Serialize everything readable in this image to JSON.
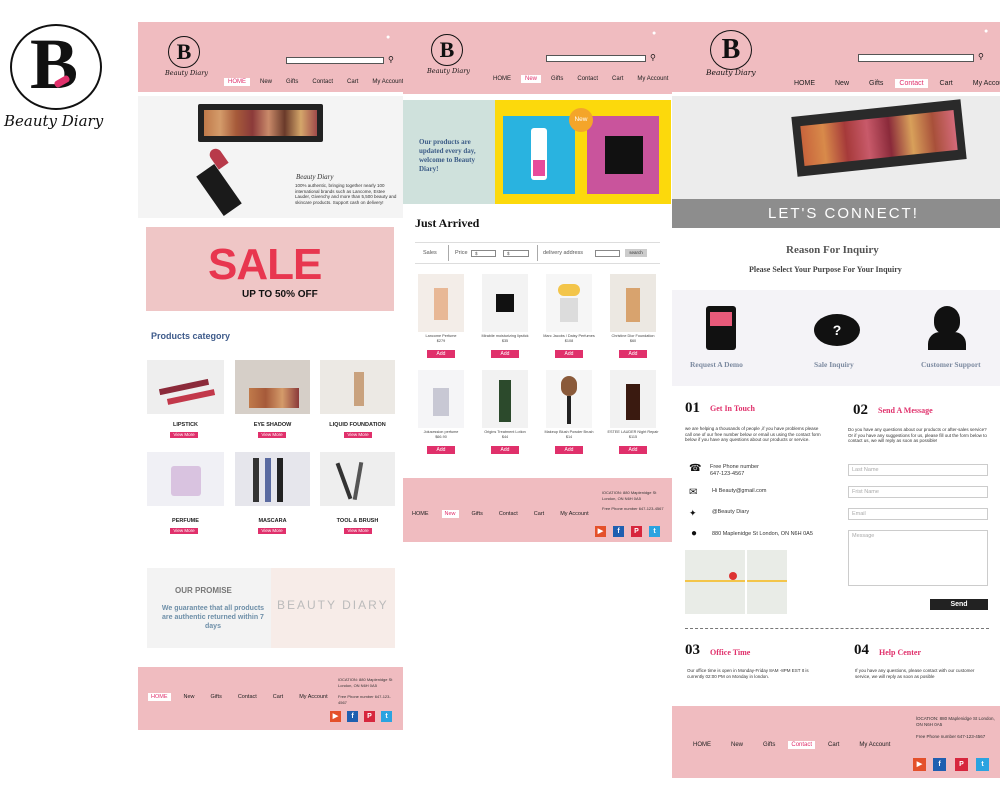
{
  "brand": {
    "initial": "B",
    "script": "Beauty Diary"
  },
  "nav": [
    "HOME",
    "New",
    "Gifts",
    "Contact",
    "Cart",
    "My Account"
  ],
  "home": {
    "hero_brand": "Beauty Diary",
    "hero_text": "100% authentic, bringing together nearly 100 international brands such as Lancome, Estee Lauder, Givenchy and more than 5,500 beauty and skincare products. Support cash on delivery!",
    "sale_title": "SALE",
    "sale_sub": "UP TO 50% OFF",
    "category_title": "Products category",
    "categories": [
      {
        "name": "LIPSTICK",
        "btn": "View More"
      },
      {
        "name": "EYE SHADOW",
        "btn": "View More"
      },
      {
        "name": "LIQUID FOUNDATION",
        "btn": "View More"
      },
      {
        "name": "PERFUME",
        "btn": "View More"
      },
      {
        "name": "MASCARA",
        "btn": "View More"
      },
      {
        "name": "TOOL & BRUSH",
        "btn": "View More"
      }
    ],
    "promise_title": "OUR PROMISE",
    "promise_text": "We guarantee that all products are authentic returned within 7 days",
    "promise_brand": "BEAUTY DIARY",
    "footer_nav": [
      "HOME",
      "New",
      "Gifts",
      "Contact",
      "Cart",
      "My Account"
    ],
    "footer_location": "lOCATION: 880  Maplenidge St  London, ON N6H 0A5",
    "footer_phone": "Free Phone number 647-123-4567"
  },
  "new": {
    "banner_text": "Our products are updated every day, welcome to Beauty Diary!",
    "badge": "New",
    "just_arrived": "Just Arrived",
    "filter_sales": "Sales",
    "filter_price": "Price",
    "price_from": "$",
    "price_to": "$",
    "filter_delivery": "delivery address",
    "search_btn": "search",
    "products": [
      {
        "name": "Lancome Perfume",
        "price": "$279",
        "btn": "Add"
      },
      {
        "name": "Mirabile moisturizing lipstick",
        "price": "$35",
        "btn": "Add"
      },
      {
        "name": "Marc Jacobs / Daisy Perfumes",
        "price": "$108",
        "btn": "Add"
      },
      {
        "name": "Christine Dior Foundation",
        "price": "$60",
        "btn": "Add"
      },
      {
        "name": "Jolusession perfume",
        "price": "$66.90",
        "btn": "Add"
      },
      {
        "name": "Origins Treatment Lotion",
        "price": "$44",
        "btn": "Add"
      },
      {
        "name": "Makeup Blush Powder Brush",
        "price": "$14",
        "btn": "Add"
      },
      {
        "name": "ESTEE LAUDER Night Repair",
        "price": "$115",
        "btn": "Add"
      }
    ],
    "footer_nav": [
      "HOME",
      "New",
      "Gifts",
      "Contact",
      "Cart",
      "My Account"
    ],
    "footer_location": "lOCATION: 880  Maplenidge St  London, ON N6H 0A5",
    "footer_phone": "Free Phone number 647-123-4567"
  },
  "contact": {
    "hero_text": "LET'S CONNECT!",
    "reason_title": "Reason For Inquiry",
    "reason_sub": "Please Select Your Purpose For Your Inquiry",
    "options": [
      "Request A Demo",
      "Sale Inquiry",
      "Customer Support"
    ],
    "s1_num": "01",
    "s1_title": "Get In Touch",
    "s1_text": "we are helping a thousands of people ,if you have problems please call one of our free number below or email us using the contact form below if you have any questions about our products or service.",
    "phone_label": "Free Phone number",
    "phone": "647-123-4567",
    "email": "Hi Beauty@gmail.com",
    "twitter": "@Beauty Diary",
    "address": "880  Maplenidge St  London, ON N6H 0A5",
    "s2_num": "02",
    "s2_title": "Send A Message",
    "s2_text": "Do you have any questions about our products or after-sales service? Or if you have any suggestions for us, please fill out the form below to contact us, we will reply as soon as possible!",
    "ph_last": "Last Name",
    "ph_first": "Frist Name",
    "ph_email": "Email",
    "ph_msg": "Message",
    "send": "Send",
    "s3_num": "03",
    "s3_title": "Office Time",
    "s3_text": "Our office time is open in Monday-Friday 8AM -8PM EST It is currently 02:00 PM on Monday in london.",
    "s4_num": "04",
    "s4_title": "Help Center",
    "s4_text": "If you have any questions, please contact with our customer service, we will reply as soon as posible",
    "footer_nav": [
      "HOME",
      "New",
      "Gifts",
      "Contact",
      "Cart",
      "My Account"
    ],
    "footer_location": "lOCATION: 880  Maplenidge St  London, ON N6H 0A5",
    "footer_phone": "Free Phone number 647-123-4567"
  },
  "colors": {
    "pink": "#f0bcc0",
    "accent": "#e0306b",
    "yellow": "#fcd90c"
  },
  "icons": [
    "search-icon",
    "user-icon",
    "phone-icon",
    "mail-icon",
    "twitter-icon",
    "location-icon",
    "youtube-icon",
    "facebook-icon",
    "pinterest-icon",
    "twitter-icon"
  ]
}
